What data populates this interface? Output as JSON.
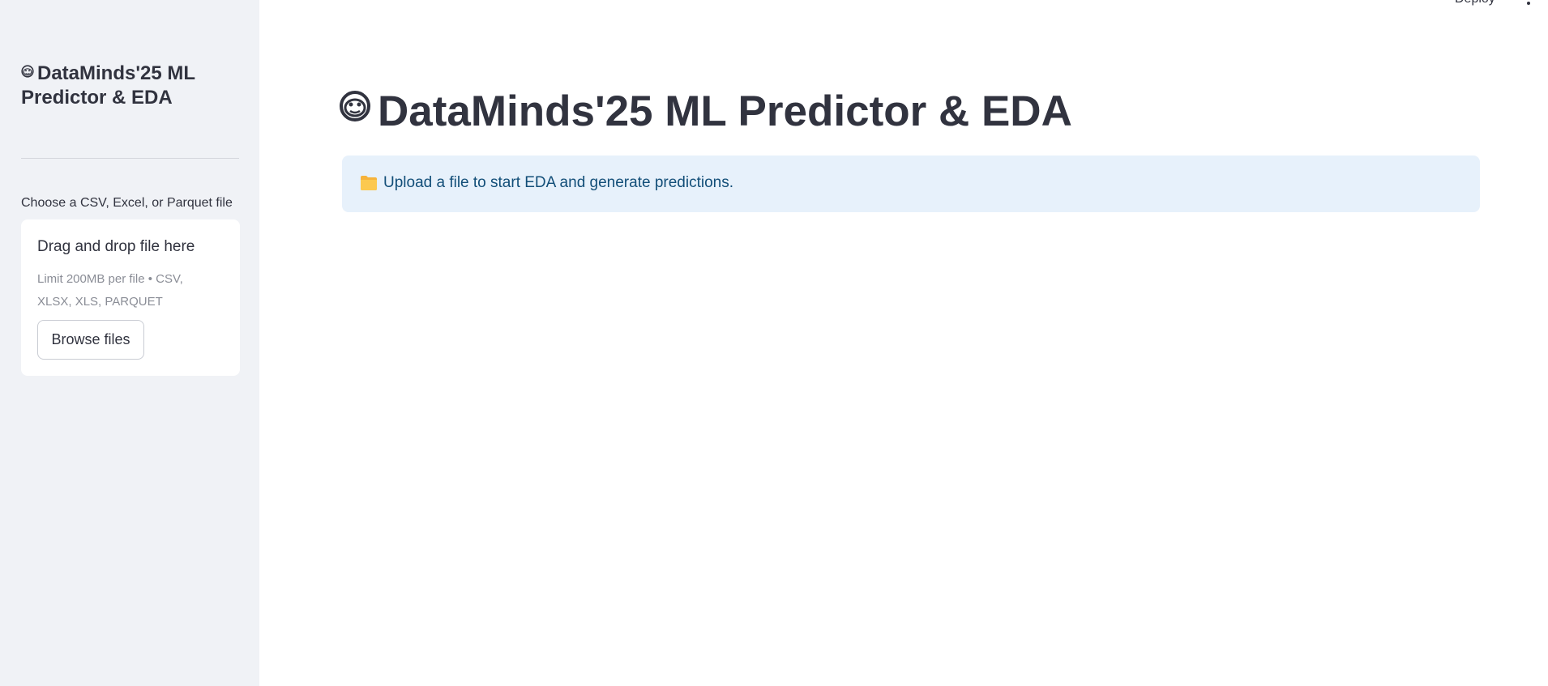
{
  "header": {
    "deploy_label": "Deploy",
    "menu_icon": "more-vertical-icon"
  },
  "sidebar": {
    "title": "DataMinds'25 ML Predictor & EDA",
    "title_icon": "monkey-face-icon",
    "uploader": {
      "label": "Choose a CSV, Excel, or Parquet file",
      "drop_text": "Drag and drop file here",
      "limit_text": "Limit 200MB per file • CSV, XLSX, XLS, PARQUET",
      "browse_label": "Browse files"
    }
  },
  "main": {
    "title": "DataMinds'25 ML Predictor & EDA",
    "title_icon": "monkey-face-icon",
    "info": {
      "icon": "folder-icon",
      "text": "Upload a file to start EDA and generate predictions."
    }
  },
  "colors": {
    "sidebar_bg": "#f0f2f6",
    "info_bg": "#e7f1fb",
    "info_text": "#124e78",
    "text": "#31333f"
  }
}
